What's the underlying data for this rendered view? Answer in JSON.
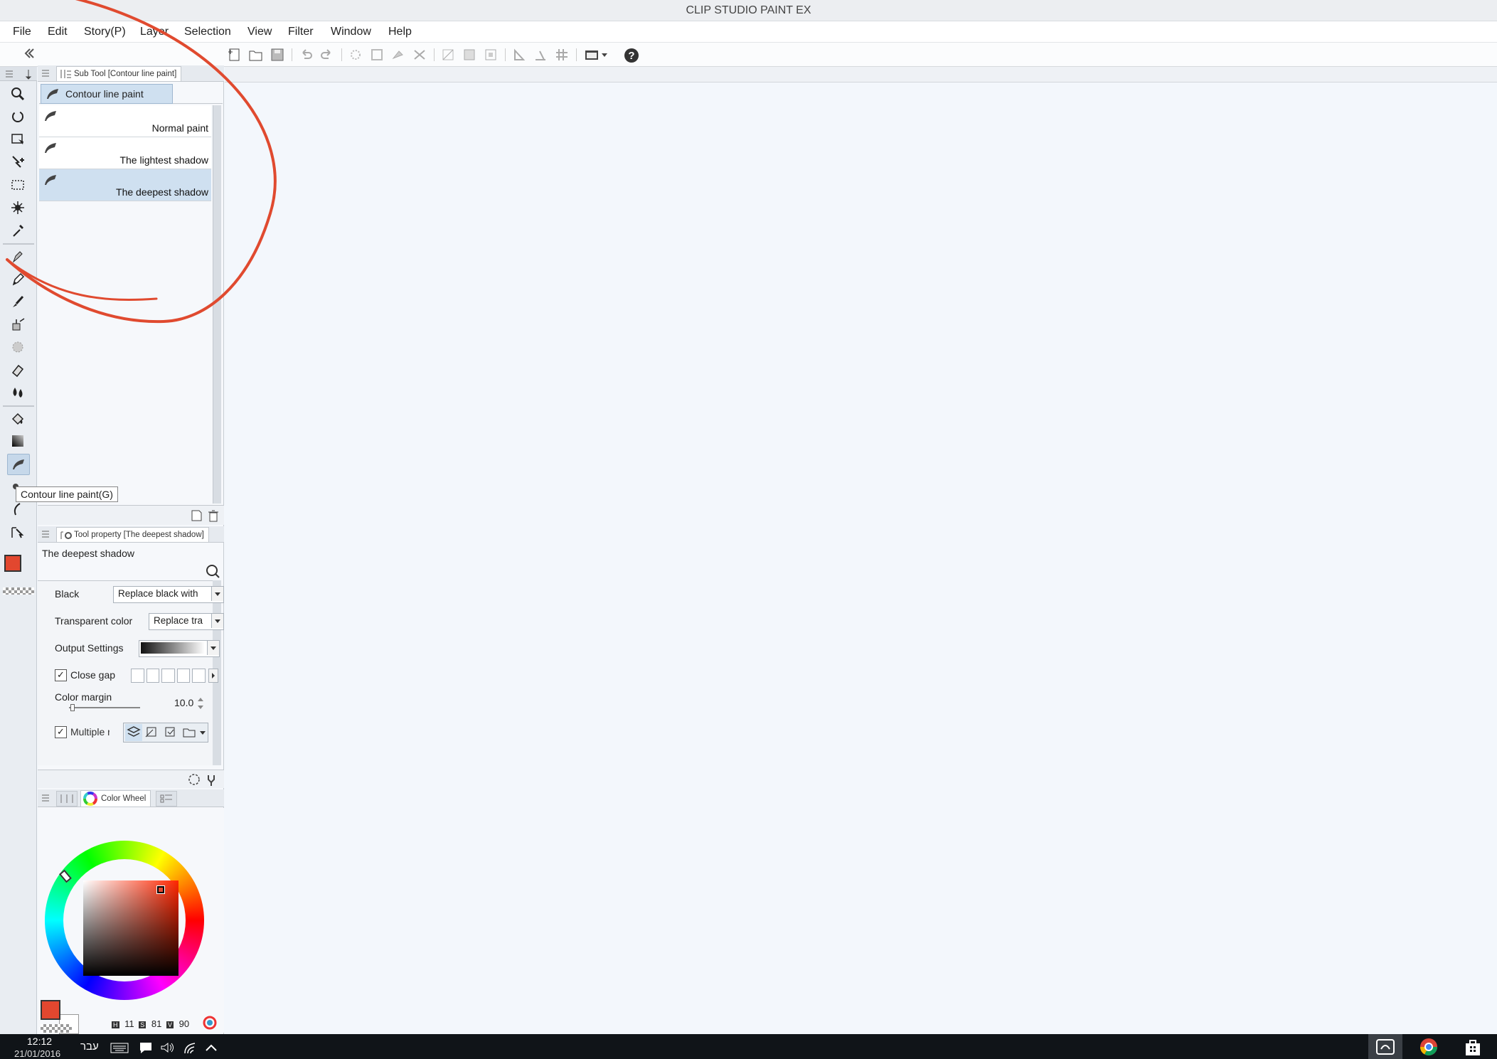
{
  "app": {
    "title": "CLIP STUDIO PAINT EX"
  },
  "menu": [
    "File",
    "Edit",
    "Story(P)",
    "Layer",
    "Selection",
    "View",
    "Filter",
    "Window",
    "Help"
  ],
  "subtool_panel": {
    "tab_label": "Sub Tool [Contour line paint]",
    "group_button": "Contour line paint",
    "items": [
      "Normal paint",
      "The lightest shadow",
      "The deepest shadow"
    ],
    "selected": "The deepest shadow"
  },
  "tooltip": {
    "text": "Contour line paint(G)"
  },
  "tool_property": {
    "tab_label": "Tool property [The deepest shadow]",
    "preset_name": "The deepest shadow",
    "rows": {
      "black_label": "Black",
      "black_value": "Replace black with",
      "transparent_label": "Transparent color",
      "transparent_value": "Replace tra",
      "output_label": "Output Settings",
      "close_gap_label": "Close gap",
      "close_gap_checked": true,
      "color_margin_label": "Color margin",
      "color_margin_value": "10.0",
      "multiple_label": "Multiple re",
      "multiple_checked": true
    }
  },
  "color_panel": {
    "tab_label": "Color Wheel",
    "main_color": "#e2472f",
    "sub_color": "#ffffff",
    "hsv": {
      "h_label": "H",
      "h": "11",
      "s_label": "S",
      "s": "81",
      "v_label": "V",
      "v": "90"
    }
  },
  "taskbar": {
    "time": "12:12",
    "date": "21/01/2016",
    "language": "עבר"
  },
  "colors": {
    "accent_selection": "#cfe0f0",
    "annotation_circle": "#e04a2f",
    "taskbar_bg": "#101418"
  },
  "icons": [
    "zoom-icon",
    "rotate-icon",
    "object-icon",
    "move-layer-icon",
    "selection-icon",
    "auto-select-icon",
    "eyedropper-icon",
    "pen-icon",
    "pencil-icon",
    "brush-icon",
    "airbrush-icon",
    "decoration-icon",
    "eraser-icon",
    "blend-icon",
    "fill-icon",
    "gradient-icon",
    "contour-line-paint-icon",
    "figure-icon",
    "ruler-icon",
    "correct-line-icon"
  ]
}
